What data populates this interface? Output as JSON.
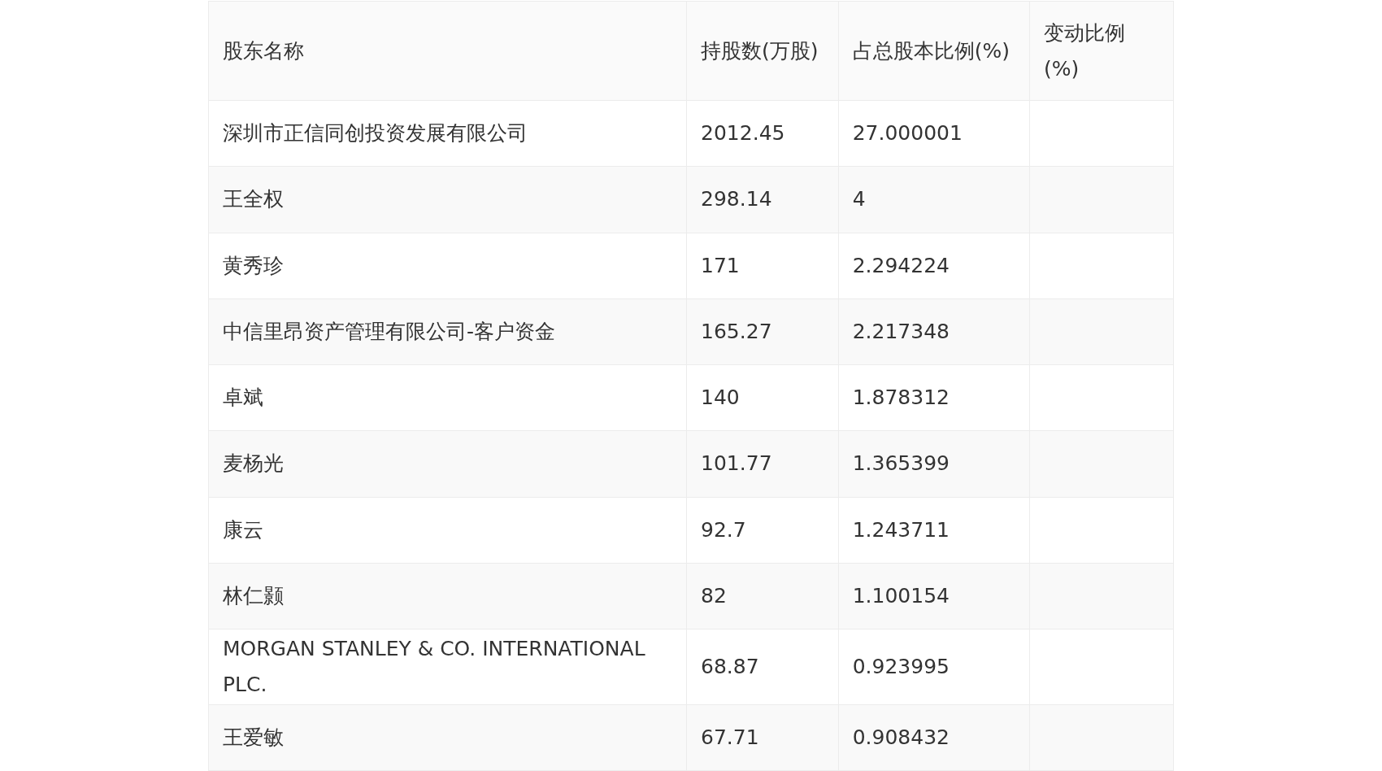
{
  "table": {
    "columns": [
      "股东名称",
      "持股数(万股)",
      "占总股本比例(%)",
      "变动比例(%)"
    ],
    "rows": [
      {
        "name": "深圳市正信同创投资发展有限公司",
        "shares": "2012.45",
        "ratio": "27.000001"
      },
      {
        "name": "王全权",
        "shares": "298.14",
        "ratio": "4"
      },
      {
        "name": "黄秀珍",
        "shares": "171",
        "ratio": "2.294224"
      },
      {
        "name": "中信里昂资产管理有限公司-客户资金",
        "shares": "165.27",
        "ratio": "2.217348"
      },
      {
        "name": "卓斌",
        "shares": "140",
        "ratio": "1.878312"
      },
      {
        "name": "麦杨光",
        "shares": "101.77",
        "ratio": "1.365399"
      },
      {
        "name": "康云",
        "shares": "92.7",
        "ratio": "1.243711"
      },
      {
        "name": "林仁颢",
        "shares": "82",
        "ratio": "1.100154"
      },
      {
        "name": "MORGAN STANLEY & CO. INTERNATIONAL PLC.",
        "shares": "68.87",
        "ratio": "0.923995"
      },
      {
        "name": "王爱敏",
        "shares": "67.71",
        "ratio": "0.908432"
      }
    ]
  }
}
